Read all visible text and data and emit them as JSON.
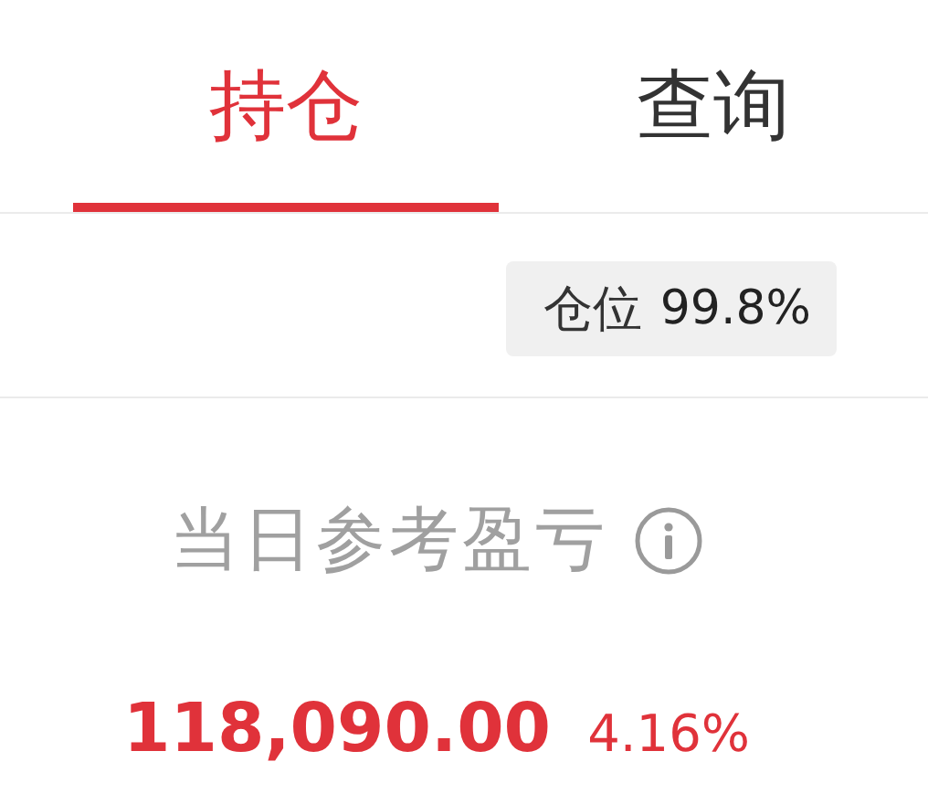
{
  "tabs": [
    {
      "label": "持仓",
      "selected": true
    },
    {
      "label": "查询",
      "selected": false
    }
  ],
  "position_badge": {
    "label": "仓位",
    "value": "99.8%"
  },
  "daily_pnl": {
    "label": "当日参考盈亏",
    "amount": "118,090.00",
    "percent": "4.16%"
  }
}
